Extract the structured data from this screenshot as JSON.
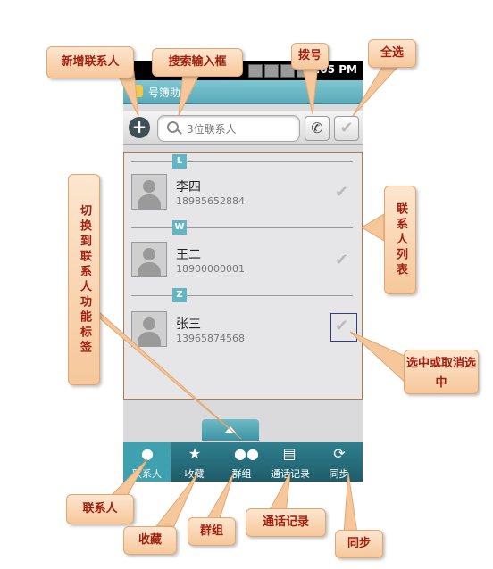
{
  "statusbar": {
    "time": "3:05 PM"
  },
  "titlebar": {
    "title": "号簿助手"
  },
  "toolbar": {
    "add_icon": "+",
    "search_placeholder": "3位联系人"
  },
  "contacts": [
    {
      "letter": "L",
      "name": "李四",
      "phone": "18985652884",
      "selected": false
    },
    {
      "letter": "W",
      "name": "王二",
      "phone": "18900000001",
      "selected": false
    },
    {
      "letter": "Z",
      "name": "张三",
      "phone": "13965874568",
      "selected": true
    }
  ],
  "tabs": [
    {
      "label": "联系人",
      "icon": "person-icon"
    },
    {
      "label": "收藏",
      "icon": "star-icon"
    },
    {
      "label": "群组",
      "icon": "group-icon"
    },
    {
      "label": "通话记录",
      "icon": "call-log-icon"
    },
    {
      "label": "同步",
      "icon": "sync-icon"
    }
  ],
  "callouts": {
    "add_contact": "新增联系人",
    "search_input": "搜索输入框",
    "dial": "拨号",
    "select_all": "全选",
    "contact_list": "联系人列表",
    "switch_tab": "切换到联系人功能标签",
    "toggle_select": "选中或取消选中",
    "tab_contacts": "联系人",
    "tab_favorites": "收藏",
    "tab_groups": "群组",
    "tab_calllog": "通话记录",
    "tab_sync": "同步"
  }
}
